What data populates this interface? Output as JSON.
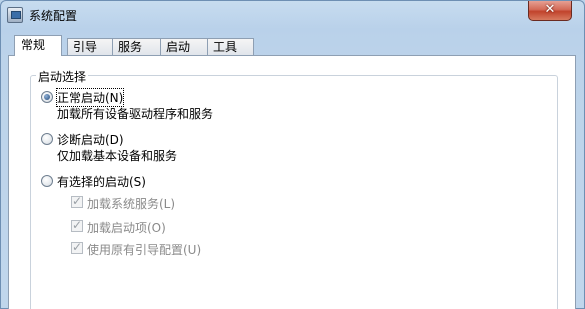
{
  "window": {
    "title": "系统配置",
    "close_label": "✕"
  },
  "tabs": [
    "常规",
    "引导",
    "服务",
    "启动",
    "工具"
  ],
  "startup_selection": {
    "legend": "启动选择",
    "normal": {
      "label": "正常启动(N)",
      "description": "加载所有设备驱动程序和服务",
      "selected": true
    },
    "diagnostic": {
      "label": "诊断启动(D)",
      "description": "仅加载基本设备和服务",
      "selected": false
    },
    "selective": {
      "label": "有选择的启动(S)",
      "selected": false,
      "options": [
        {
          "label": "加载系统服务(L)",
          "checked": true,
          "enabled": false
        },
        {
          "label": "加载启动项(O)",
          "checked": true,
          "enabled": false
        },
        {
          "label": "使用原有引导配置(U)",
          "checked": true,
          "enabled": false
        }
      ]
    }
  }
}
